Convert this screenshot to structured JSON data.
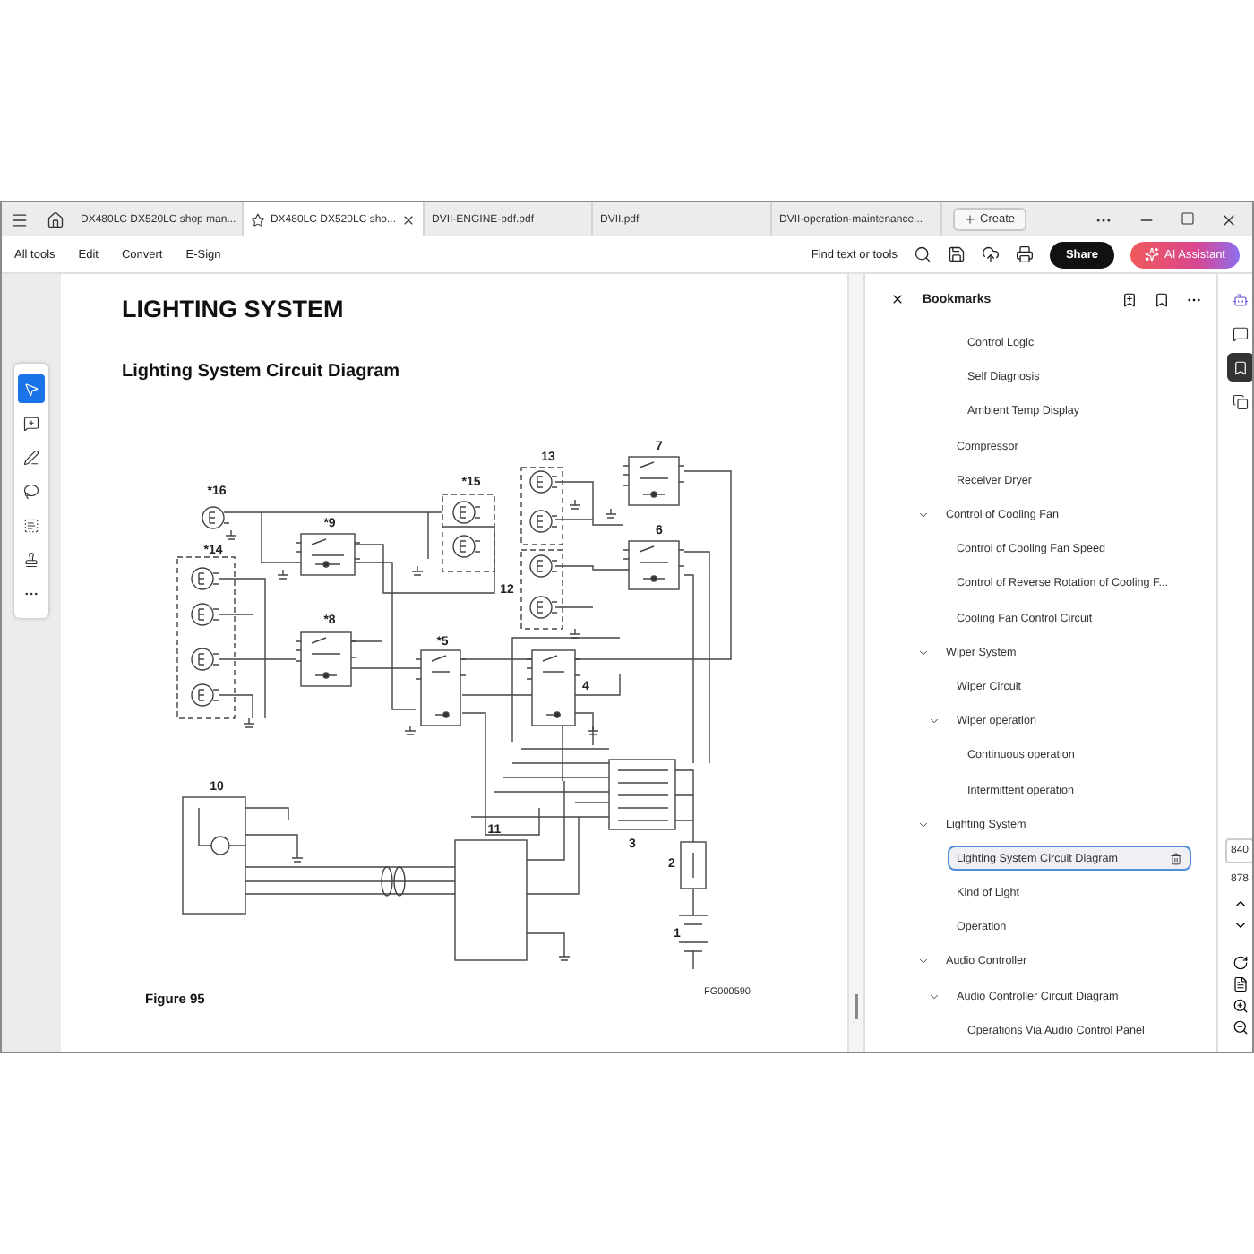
{
  "tabs": [
    {
      "label": "DX480LC DX520LC shop man...",
      "selected": false
    },
    {
      "label": "DX480LC DX520LC sho...",
      "selected": true
    },
    {
      "label": "DVII-ENGINE-pdf.pdf",
      "selected": false
    },
    {
      "label": "DVII.pdf",
      "selected": false
    },
    {
      "label": "DVII-operation-maintenance...",
      "selected": false
    }
  ],
  "create_button": "Create",
  "menu": [
    "All tools",
    "Edit",
    "Convert",
    "E-Sign"
  ],
  "search": {
    "label": "Find text or tools"
  },
  "share_button": "Share",
  "ai_button": "AI Assistant",
  "tools": [
    {
      "kind": "select",
      "selected": true
    },
    {
      "kind": "comment",
      "selected": false
    },
    {
      "kind": "pen",
      "selected": false
    },
    {
      "kind": "lasso",
      "selected": false
    },
    {
      "kind": "text",
      "selected": false
    },
    {
      "kind": "stamp",
      "selected": false
    },
    {
      "kind": "more",
      "selected": false
    }
  ],
  "document": {
    "title": "LIGHTING SYSTEM",
    "heading": "Lighting System Circuit Diagram",
    "figure_caption": "Figure 95",
    "diagram": {
      "code": "FG000590",
      "part_labels": [
        "*16",
        "*15",
        "*14",
        "*9",
        "*8",
        "13",
        "12",
        "7",
        "6",
        "*5",
        "4",
        "10",
        "11",
        "3",
        "2",
        "1"
      ]
    }
  },
  "bookmarks": {
    "title": "Bookmarks",
    "items": [
      {
        "children": [
          {
            "children": [
              {
                "label": "Control Logic",
                "selected": false
              },
              {
                "label": "Self Diagnosis",
                "selected": false
              },
              {
                "label": "Ambient Temp Display",
                "selected": false
              }
            ]
          },
          {
            "label": "Compressor",
            "selected": false
          },
          {
            "label": "Receiver Dryer",
            "selected": false
          }
        ]
      },
      {
        "label": "Control of Cooling Fan",
        "selected": false,
        "expanded": true,
        "children": [
          {
            "label": "Control of Cooling Fan Speed",
            "selected": false
          },
          {
            "label": "Control of Reverse Rotation of Cooling F...",
            "selected": false
          },
          {
            "label": "Cooling Fan Control Circuit",
            "selected": false
          }
        ]
      },
      {
        "label": "Wiper System",
        "selected": false,
        "expanded": true,
        "children": [
          {
            "label": "Wiper Circuit",
            "selected": false
          },
          {
            "label": "Wiper operation",
            "selected": false,
            "expanded": true,
            "children": [
              {
                "label": "Continuous operation",
                "selected": false
              },
              {
                "label": "Intermittent operation",
                "selected": false
              }
            ]
          }
        ]
      },
      {
        "label": "Lighting System",
        "selected": false,
        "expanded": true,
        "children": [
          {
            "label": "Lighting System Circuit Diagram",
            "selected": true
          },
          {
            "label": "Kind of Light",
            "selected": false
          },
          {
            "label": "Operation",
            "selected": false
          }
        ]
      },
      {
        "label": "Audio Controller",
        "selected": false,
        "expanded": true,
        "children": [
          {
            "label": "Audio Controller Circuit Diagram",
            "selected": false,
            "expanded": true,
            "children": [
              {
                "label": "Operations Via Audio Control Panel",
                "selected": false
              }
            ]
          }
        ]
      }
    ]
  },
  "rail": [
    {
      "kind": "ai",
      "selected": false
    },
    {
      "kind": "comments",
      "selected": false
    },
    {
      "kind": "bookmarks",
      "selected": true
    },
    {
      "kind": "pages",
      "selected": false
    }
  ],
  "page_nav": {
    "current_page": "840",
    "total_pages": "878"
  }
}
